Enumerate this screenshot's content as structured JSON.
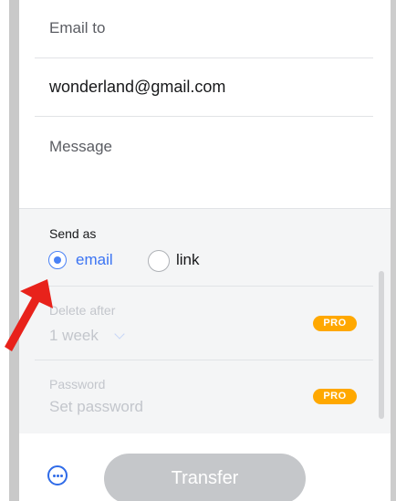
{
  "form": {
    "email_to_label": "Email to",
    "email_value": "wonderland@gmail.com",
    "message_placeholder": "Message"
  },
  "send_as": {
    "label": "Send as",
    "options": [
      {
        "label": "email",
        "selected": true
      },
      {
        "label": "link",
        "selected": false
      }
    ]
  },
  "delete_after": {
    "label": "Delete after",
    "value": "1 week",
    "badge": "PRO"
  },
  "password": {
    "label": "Password",
    "placeholder": "Set password",
    "badge": "PRO"
  },
  "footer": {
    "more_icon": "more-horizontal-circle-icon",
    "transfer_label": "Transfer"
  },
  "colors": {
    "accent": "#4a82f6",
    "pro_badge": "#ffa800",
    "disabled_button": "#c5c7ca",
    "annotation_arrow": "#e8221b"
  }
}
